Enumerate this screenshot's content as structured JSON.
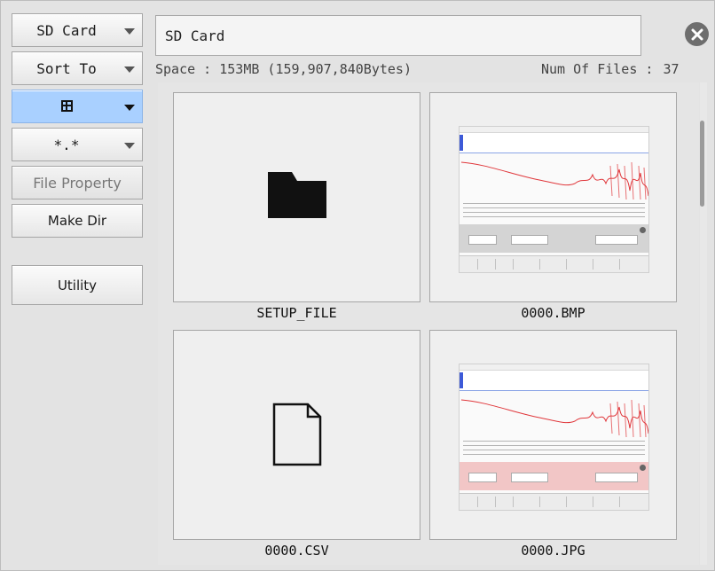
{
  "sidebar": {
    "storage_dropdown": "SD Card",
    "sort_dropdown": "Sort To",
    "view_icon": "grid-view-icon",
    "filter_dropdown": "*.*",
    "file_property": "File Property",
    "make_dir": "Make Dir",
    "utility": "Utility"
  },
  "header": {
    "path": "SD Card",
    "space_label": "Space : 153MB (159,907,840Bytes)",
    "num_files_label": "Num Of Files :",
    "num_files_value": "37",
    "close_icon": "close-icon"
  },
  "files": [
    {
      "name": "SETUP_FILE",
      "kind": "folder-icon"
    },
    {
      "name": "0000.BMP",
      "kind": "bmp-thumbnail"
    },
    {
      "name": "0000.CSV",
      "kind": "document-icon"
    },
    {
      "name": "0000.JPG",
      "kind": "jpg-thumbnail"
    }
  ],
  "colors": {
    "selected_button": "#a9d0ff",
    "waveform": "#e0373b",
    "jpg_dialog": "#f2c6c6"
  }
}
